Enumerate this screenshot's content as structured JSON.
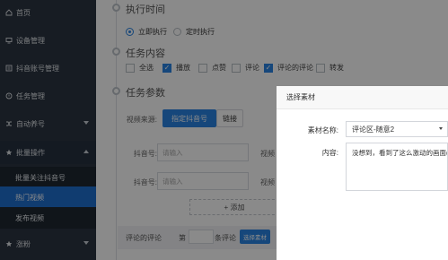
{
  "sidebar": {
    "items": [
      {
        "label": "首页",
        "icon": "home-icon"
      },
      {
        "label": "设备管理",
        "icon": "device-icon"
      },
      {
        "label": "抖音账号管理",
        "icon": "account-icon"
      },
      {
        "label": "任务管理",
        "icon": "task-icon"
      },
      {
        "label": "自动养号",
        "icon": "shuffle-icon"
      },
      {
        "label": "批量操作",
        "icon": "star-icon"
      },
      {
        "label": "涨粉",
        "icon": "star-icon"
      }
    ],
    "sub_items": [
      "批量关注抖音号",
      "热门视频",
      "发布视频"
    ]
  },
  "main": {
    "exec_section": {
      "title": "执行时间",
      "options": [
        "立即执行",
        "定时执行"
      ]
    },
    "content_section": {
      "title": "任务内容",
      "options": [
        {
          "label": "全选",
          "checked": false
        },
        {
          "label": "播放",
          "checked": true
        },
        {
          "label": "点赞",
          "checked": false
        },
        {
          "label": "评论",
          "checked": false
        },
        {
          "label": "评论的评论",
          "checked": true
        },
        {
          "label": "转发",
          "checked": false
        }
      ]
    },
    "params_section": {
      "title": "任务参数",
      "source_label": "视频来源:",
      "source_tabs": [
        "指定抖音号",
        "链接"
      ],
      "rows": [
        {
          "label": "抖音号:",
          "placeholder": "请输入",
          "side": "视频"
        },
        {
          "label": "抖音号:",
          "placeholder": "请输入",
          "side": "视频"
        }
      ],
      "add_label": "+ 添加",
      "bottom": {
        "label": "评论的评论",
        "prefix": "第",
        "suffix": "条评论",
        "button": "选择素材"
      }
    }
  },
  "modal": {
    "title": "选择素材",
    "name_label": "素材名称:",
    "name_value": "评论区-随意2",
    "content_label": "内容:",
    "content_value": "没想到，看到了这么激动的画面(丰"
  },
  "colors": {
    "sidebar_bg": "#2c3542",
    "accent": "#2a84e3",
    "active_item": "#1e6fd0"
  }
}
